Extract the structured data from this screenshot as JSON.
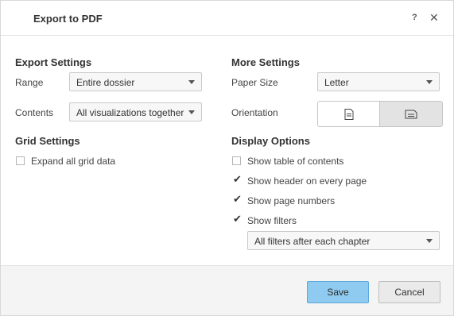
{
  "dialog": {
    "title": "Export to PDF",
    "help_label": "?",
    "close_label": "✕"
  },
  "export_settings": {
    "title": "Export Settings",
    "range_label": "Range",
    "range_value": "Entire dossier",
    "contents_label": "Contents",
    "contents_value": "All visualizations together"
  },
  "grid_settings": {
    "title": "Grid Settings",
    "expand_label": "Expand all grid data",
    "expand_checked": false
  },
  "more_settings": {
    "title": "More Settings",
    "paper_size_label": "Paper Size",
    "paper_size_value": "Letter",
    "orientation_label": "Orientation",
    "orientation_selected": "landscape"
  },
  "display_options": {
    "title": "Display Options",
    "items": [
      {
        "label": "Show table of contents",
        "checked": false
      },
      {
        "label": "Show header on every page",
        "checked": true
      },
      {
        "label": "Show page numbers",
        "checked": true
      },
      {
        "label": "Show filters",
        "checked": true
      }
    ],
    "filters_mode_value": "All filters after each chapter"
  },
  "footer": {
    "save_label": "Save",
    "cancel_label": "Cancel"
  },
  "colors": {
    "primary_button": "#8fcbf0",
    "primary_border": "#5aa9dc",
    "footer_bg": "#f4f4f4"
  },
  "icons": {
    "portrait": "document-portrait-icon",
    "landscape": "document-landscape-icon",
    "check": "checkmark-icon"
  }
}
